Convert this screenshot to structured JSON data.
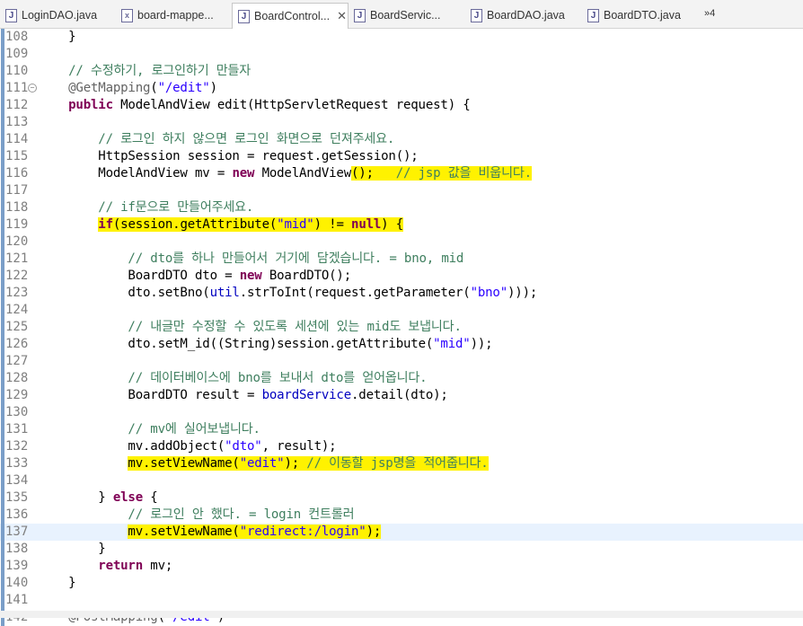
{
  "tabs": [
    {
      "label": "LoginDAO.java",
      "icon": "java-file-icon",
      "active": false
    },
    {
      "label": "board-mappe...",
      "icon": "xml-file-icon",
      "active": false
    },
    {
      "label": "BoardControl...",
      "icon": "java-file-icon",
      "active": true
    },
    {
      "label": "BoardServic...",
      "icon": "java-file-icon",
      "active": false
    },
    {
      "label": "BoardDAO.java",
      "icon": "java-file-icon",
      "active": false
    },
    {
      "label": "BoardDTO.java",
      "icon": "java-file-icon",
      "active": false
    }
  ],
  "tab_close_glyph": "✕",
  "tab_overflow": "»4",
  "highlight_color": "#fff200",
  "lines": [
    {
      "num": "108",
      "tokens": [
        [
          "plain",
          "    }"
        ]
      ]
    },
    {
      "num": "109",
      "tokens": []
    },
    {
      "num": "110",
      "tokens": [
        [
          "cm",
          "    // 수정하기, 로그인하기 만들자"
        ]
      ]
    },
    {
      "num": "111",
      "fold": true,
      "tokens": [
        [
          "an",
          "    @GetMapping"
        ],
        [
          "plain",
          "("
        ],
        [
          "st",
          "\"/edit\""
        ],
        [
          "plain",
          ")"
        ]
      ]
    },
    {
      "num": "112",
      "tokens": [
        [
          "kw",
          "    public "
        ],
        [
          "plain",
          "ModelAndView edit(HttpServletRequest "
        ],
        [
          "var",
          "request"
        ],
        [
          "plain",
          ") {"
        ]
      ]
    },
    {
      "num": "113",
      "tokens": []
    },
    {
      "num": "114",
      "tokens": [
        [
          "cm",
          "        // 로그인 하지 않으면 로그인 화면으로 던져주세요."
        ]
      ]
    },
    {
      "num": "115",
      "tokens": [
        [
          "plain",
          "        HttpSession "
        ],
        [
          "var",
          "session"
        ],
        [
          "plain",
          " = "
        ],
        [
          "var",
          "request"
        ],
        [
          "plain",
          ".getSession();"
        ]
      ]
    },
    {
      "num": "116",
      "tokens": [
        [
          "plain",
          "        ModelAndView "
        ],
        [
          "var",
          "mv"
        ],
        [
          "plain",
          " = "
        ],
        [
          "kw",
          "new "
        ],
        [
          "plain",
          "ModelAndView"
        ],
        [
          "hl",
          "();   "
        ],
        [
          "hlcm",
          "// jsp 값을 비웁니다."
        ]
      ]
    },
    {
      "num": "117",
      "tokens": []
    },
    {
      "num": "118",
      "tokens": [
        [
          "cm",
          "        // if문으로 만들어주세요."
        ]
      ]
    },
    {
      "num": "119",
      "tokens": [
        [
          "plain",
          "        "
        ],
        [
          "hlkw",
          "if"
        ],
        [
          "hl",
          "("
        ],
        [
          "hlvar",
          "session"
        ],
        [
          "hl",
          ".getAttribute("
        ],
        [
          "hlst",
          "\"mid\""
        ],
        [
          "hl",
          ") != "
        ],
        [
          "hlkw",
          "null"
        ],
        [
          "hl",
          ") {"
        ]
      ]
    },
    {
      "num": "120",
      "tokens": []
    },
    {
      "num": "121",
      "tokens": [
        [
          "cm",
          "            // dto를 하나 만들어서 거기에 담겠습니다. = bno, mid"
        ]
      ]
    },
    {
      "num": "122",
      "tokens": [
        [
          "plain",
          "            BoardDTO "
        ],
        [
          "var",
          "dto"
        ],
        [
          "plain",
          " = "
        ],
        [
          "kw",
          "new "
        ],
        [
          "plain",
          "BoardDTO();"
        ]
      ]
    },
    {
      "num": "123",
      "tokens": [
        [
          "var",
          "            dto"
        ],
        [
          "plain",
          ".setBno("
        ],
        [
          "fld",
          "util"
        ],
        [
          "plain",
          ".strToInt("
        ],
        [
          "var",
          "request"
        ],
        [
          "plain",
          ".getParameter("
        ],
        [
          "st",
          "\"bno\""
        ],
        [
          "plain",
          ")));"
        ]
      ]
    },
    {
      "num": "124",
      "tokens": []
    },
    {
      "num": "125",
      "tokens": [
        [
          "cm",
          "            // 내글만 수정할 수 있도록 세션에 있는 mid도 보냅니다."
        ]
      ]
    },
    {
      "num": "126",
      "tokens": [
        [
          "var",
          "            dto"
        ],
        [
          "plain",
          ".setM_id((String)"
        ],
        [
          "var",
          "session"
        ],
        [
          "plain",
          ".getAttribute("
        ],
        [
          "st",
          "\"mid\""
        ],
        [
          "plain",
          "));"
        ]
      ]
    },
    {
      "num": "127",
      "tokens": []
    },
    {
      "num": "128",
      "tokens": [
        [
          "cm",
          "            // 데이터베이스에 bno를 보내서 dto를 얻어옵니다."
        ]
      ]
    },
    {
      "num": "129",
      "tokens": [
        [
          "plain",
          "            BoardDTO "
        ],
        [
          "var",
          "result"
        ],
        [
          "plain",
          " = "
        ],
        [
          "fld",
          "boardService"
        ],
        [
          "plain",
          ".detail("
        ],
        [
          "var",
          "dto"
        ],
        [
          "plain",
          ");"
        ]
      ]
    },
    {
      "num": "130",
      "tokens": []
    },
    {
      "num": "131",
      "tokens": [
        [
          "cm",
          "            // mv에 실어보냅니다."
        ]
      ]
    },
    {
      "num": "132",
      "tokens": [
        [
          "var",
          "            mv"
        ],
        [
          "plain",
          ".addObject("
        ],
        [
          "st",
          "\"dto\""
        ],
        [
          "plain",
          ", "
        ],
        [
          "var",
          "result"
        ],
        [
          "plain",
          ");"
        ]
      ]
    },
    {
      "num": "133",
      "tokens": [
        [
          "plain",
          "            "
        ],
        [
          "hlvar",
          "mv"
        ],
        [
          "hl",
          ".setViewName("
        ],
        [
          "hlst",
          "\"edit\""
        ],
        [
          "hl",
          "); "
        ],
        [
          "hlcm",
          "// 이동할 jsp명을 적어줍니다."
        ]
      ]
    },
    {
      "num": "134",
      "tokens": []
    },
    {
      "num": "135",
      "tokens": [
        [
          "plain",
          "        } "
        ],
        [
          "kw",
          "else"
        ],
        [
          "plain",
          " {"
        ]
      ]
    },
    {
      "num": "136",
      "tokens": [
        [
          "cm",
          "            // 로그인 안 했다. = login 컨트롤러"
        ]
      ]
    },
    {
      "num": "137",
      "current": true,
      "tokens": [
        [
          "plain",
          "            "
        ],
        [
          "hlvar",
          "mv"
        ],
        [
          "hl",
          ".setViewName("
        ],
        [
          "hlst",
          "\"redirect:/login\""
        ],
        [
          "hl",
          ");"
        ]
      ]
    },
    {
      "num": "138",
      "tokens": [
        [
          "plain",
          "        }"
        ]
      ]
    },
    {
      "num": "139",
      "tokens": [
        [
          "kw",
          "        return "
        ],
        [
          "var",
          "mv"
        ],
        [
          "plain",
          ";"
        ]
      ]
    },
    {
      "num": "140",
      "tokens": [
        [
          "plain",
          "    }"
        ]
      ]
    },
    {
      "num": "141",
      "tokens": []
    },
    {
      "num": "142",
      "tokens": [
        [
          "an",
          "    @PostMapping"
        ],
        [
          "plain",
          "("
        ],
        [
          "st",
          "\"/edit\""
        ],
        [
          "plain",
          ")"
        ]
      ]
    }
  ]
}
